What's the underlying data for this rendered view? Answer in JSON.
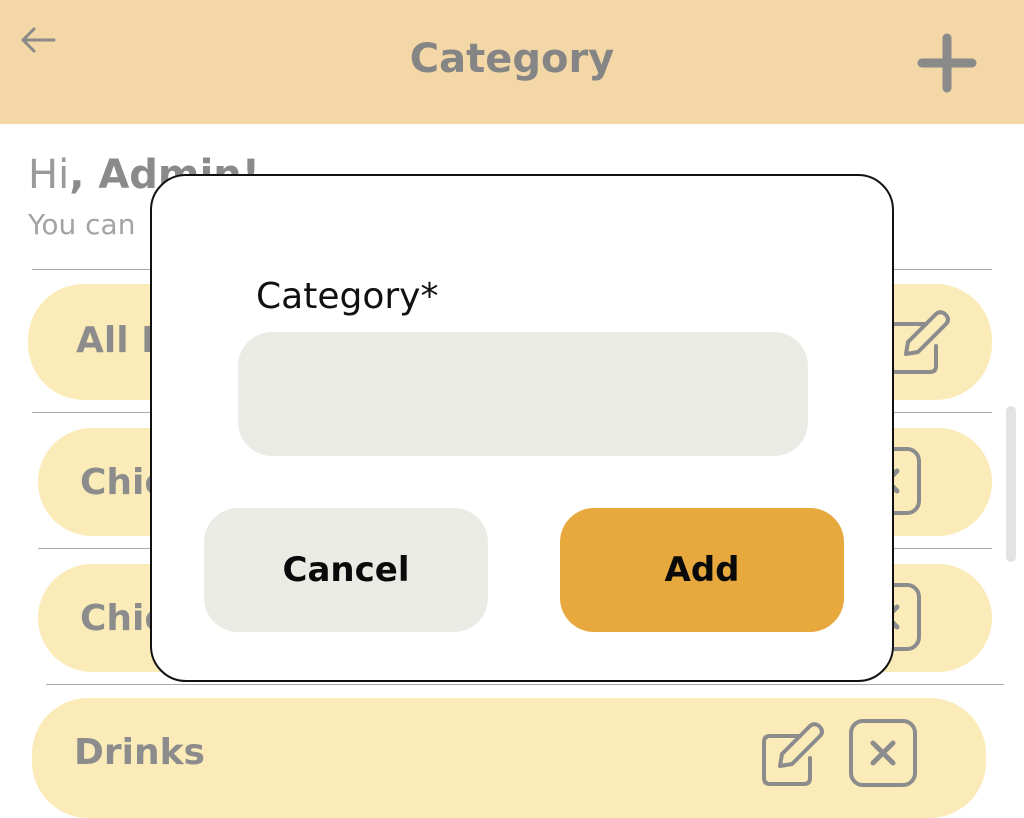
{
  "header": {
    "title": "Category",
    "back_icon": "arrow-left-icon",
    "add_icon": "plus-icon",
    "color": "#f3d7a6"
  },
  "greeting": {
    "prefix": "Hi",
    "name": ", Admin!",
    "subtext": "You can"
  },
  "categories": [
    {
      "label": "All It",
      "actions": [
        "edit-icon"
      ]
    },
    {
      "label": "Chic",
      "actions": [
        "delete-icon"
      ]
    },
    {
      "label": "Chic",
      "actions": [
        "delete-icon"
      ]
    },
    {
      "label": "Drinks",
      "actions": [
        "edit-icon",
        "delete-icon"
      ]
    }
  ],
  "modal": {
    "field_label": "Category*",
    "field_value": "",
    "field_placeholder": "",
    "cancel_label": "Cancel",
    "add_label": "Add"
  },
  "colors": {
    "card": "#fbebb8",
    "add_button": "#e7a93d",
    "cancel_button": "#ebebe6",
    "input": "#ebebe6"
  }
}
